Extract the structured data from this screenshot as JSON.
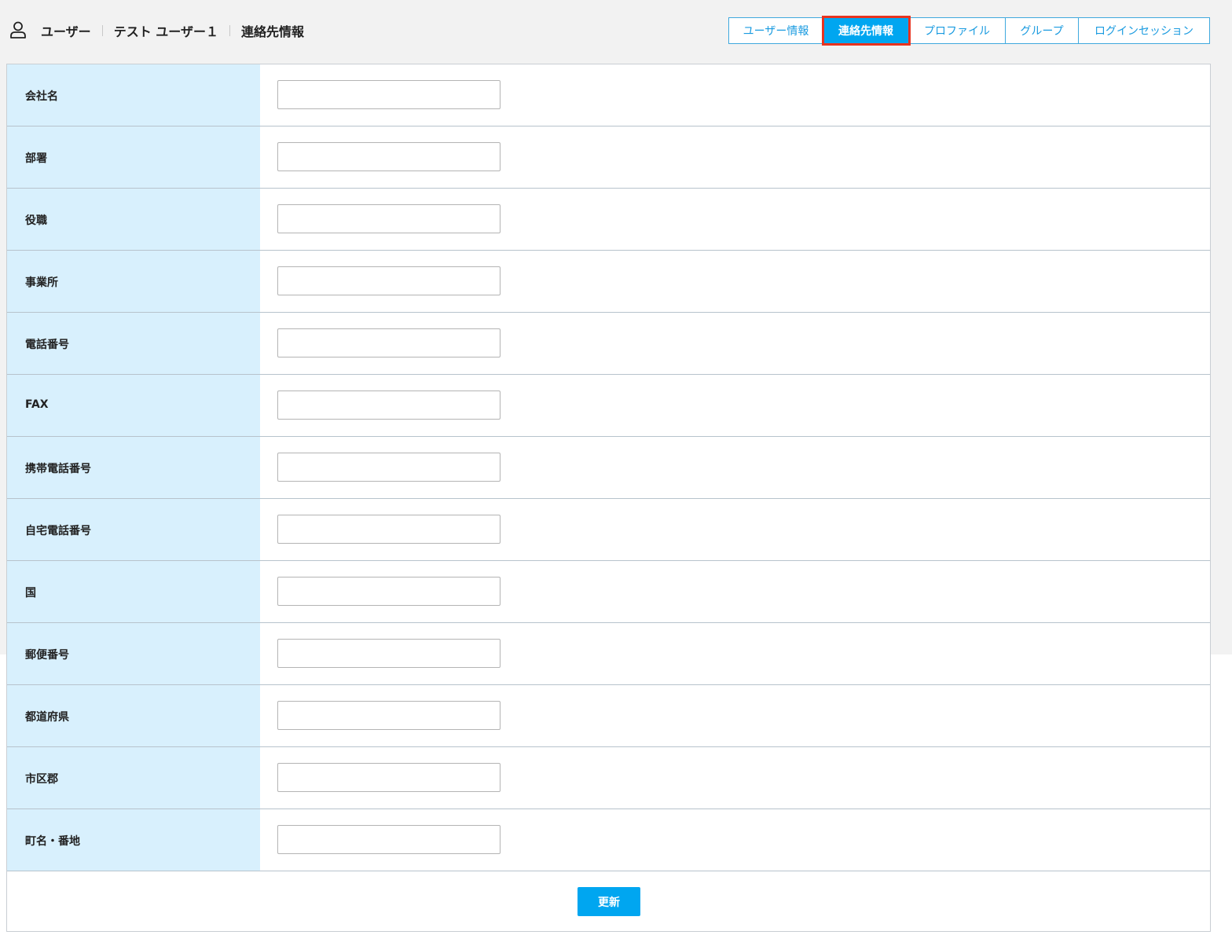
{
  "header": {
    "breadcrumb": [
      "ユーザー",
      "テスト ユーザー１",
      "連絡先情報"
    ],
    "tabs": [
      {
        "label": "ユーザー情報",
        "active": false
      },
      {
        "label": "連絡先情報",
        "active": true
      },
      {
        "label": "プロファイル",
        "active": false
      },
      {
        "label": "グループ",
        "active": false
      },
      {
        "label": "ログインセッション",
        "active": false
      }
    ]
  },
  "form": {
    "fields": [
      {
        "label": "会社名",
        "value": "",
        "placeholder": ""
      },
      {
        "label": "部署",
        "value": "",
        "placeholder": ""
      },
      {
        "label": "役職",
        "value": "",
        "placeholder": ""
      },
      {
        "label": "事業所",
        "value": "",
        "placeholder": ""
      },
      {
        "label": "電話番号",
        "value": "",
        "placeholder": ""
      },
      {
        "label": "FAX",
        "value": "",
        "placeholder": ""
      },
      {
        "label": "携帯電話番号",
        "value": "",
        "placeholder": ""
      },
      {
        "label": "自宅電話番号",
        "value": "",
        "placeholder": ""
      },
      {
        "label": "国",
        "value": "",
        "placeholder": ""
      },
      {
        "label": "郵便番号",
        "value": "",
        "placeholder": ""
      },
      {
        "label": "都道府県",
        "value": "",
        "placeholder": ""
      },
      {
        "label": "市区郡",
        "value": "",
        "placeholder": ""
      },
      {
        "label": "町名・番地",
        "value": "",
        "placeholder": ""
      }
    ],
    "submit_label": "更新"
  },
  "colors": {
    "accent": "#00a6f0",
    "tab_border": "#3fa9de",
    "active_tab_outline": "#e8331f",
    "label_background": "#d8f0fd",
    "page_background": "#f2f2f2"
  },
  "icons": {
    "header_icon": "user-icon"
  }
}
